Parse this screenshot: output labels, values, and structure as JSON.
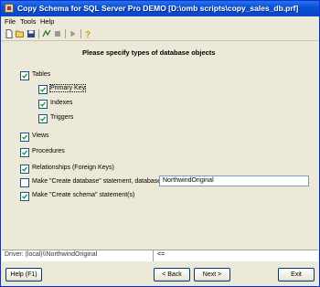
{
  "window": {
    "title": "Copy Schema for SQL Server Pro DEMO [D:\\omb scripts\\copy_sales_db.prf]"
  },
  "menu": [
    "File",
    "Tools",
    "Help"
  ],
  "toolbar_icons": [
    "new-document-icon",
    "open-folder-icon",
    "save-icon",
    "run-icon",
    "stop-icon",
    "play-icon",
    "help-icon"
  ],
  "main": {
    "heading": "Please specify types of database objects",
    "options": {
      "tables": {
        "label": "Tables",
        "checked": true
      },
      "primary_key": {
        "label": "Primary Key",
        "checked": true
      },
      "indexes": {
        "label": "Indexes",
        "checked": true
      },
      "triggers": {
        "label": "Triggers",
        "checked": true
      },
      "views": {
        "label": "Views",
        "checked": true
      },
      "procedures": {
        "label": "Procedures",
        "checked": true
      },
      "relationships": {
        "label": "Relationships (Foreign Keys)",
        "checked": true
      },
      "create_database": {
        "label": "Make \"Create database\" statement, database :",
        "checked": false
      },
      "create_schema": {
        "label": "Make \"Create schema\" statement(s)",
        "checked": true
      }
    },
    "database_name": "NorthwindOriginal"
  },
  "status": {
    "driver": "Driver: (local)\\\\NorthwindOriginal",
    "arrow": "<="
  },
  "buttons": {
    "help": "Help (F1)",
    "back": "< Back",
    "next": "Next >",
    "exit": "Exit"
  }
}
